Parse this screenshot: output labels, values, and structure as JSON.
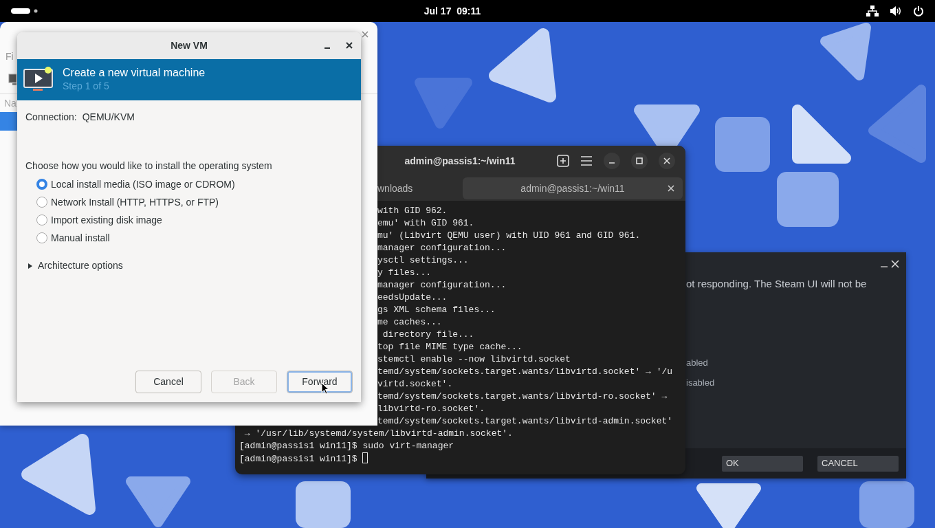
{
  "top_bar": {
    "clock": "Jul 17  09:11"
  },
  "vm_manager_window": {
    "menu_fragment": "Fi",
    "column_fragment": "Na"
  },
  "new_vm_dialog": {
    "title": "New VM",
    "header": {
      "title": "Create a new virtual machine",
      "subtitle": "Step 1 of 5"
    },
    "connection_label": "Connection:",
    "connection_value": "QEMU/KVM",
    "prompt": "Choose how you would like to install the operating system",
    "options": [
      {
        "label": "Local install media (ISO image or CDROM)",
        "selected": true
      },
      {
        "label": "Network Install (HTTP, HTTPS, or FTP)",
        "selected": false
      },
      {
        "label": "Import existing disk image",
        "selected": false
      },
      {
        "label": "Manual install",
        "selected": false
      }
    ],
    "expander": {
      "label": "Architecture options",
      "expanded": false
    },
    "buttons": [
      {
        "label": "Cancel",
        "disabled": false,
        "focused": false
      },
      {
        "label": "Back",
        "disabled": true,
        "focused": false
      },
      {
        "label": "Forward",
        "disabled": false,
        "focused": true
      }
    ]
  },
  "terminal_window": {
    "title": "admin@passis1:~/win11",
    "tabs": [
      {
        "label": "wnloads",
        "selected": false
      },
      {
        "label": "admin@passis1:~/win11",
        "selected": true
      }
    ],
    "lines": [
      {
        "kind": "cut",
        "text": "with GID 962."
      },
      {
        "kind": "cut",
        "text": "emu' with GID 961."
      },
      {
        "kind": "cut",
        "text": "mu' (Libvirt QEMU user) with UID 961 and GID 961."
      },
      {
        "kind": "cut",
        "text": "manager configuration..."
      },
      {
        "kind": "cut",
        "text": "ysctl settings..."
      },
      {
        "kind": "cut",
        "text": "y files..."
      },
      {
        "kind": "cut",
        "text": "manager configuration..."
      },
      {
        "kind": "cut",
        "text": "eedsUpdate..."
      },
      {
        "kind": "cut",
        "text": "gs XML schema files..."
      },
      {
        "kind": "cut",
        "text": "me caches..."
      },
      {
        "kind": "cut",
        "text": " directory file..."
      },
      {
        "kind": "cut",
        "text": "top file MIME type cache..."
      },
      {
        "kind": "cut",
        "text": "stemctl enable --now libvirtd.socket"
      },
      {
        "kind": "cut",
        "text": "temd/system/sockets.target.wants/libvirtd.socket' → '/u"
      },
      {
        "kind": "cut",
        "text": "virtd.socket'."
      },
      {
        "kind": "cut",
        "text": "temd/system/sockets.target.wants/libvirtd-ro.socket' →"
      },
      {
        "kind": "cut",
        "text": "libvirtd-ro.socket'."
      },
      {
        "kind": "cut",
        "text": "temd/system/sockets.target.wants/libvirtd-admin.socket'"
      },
      {
        "kind": "full",
        "text": " → '/usr/lib/systemd/system/libvirtd-admin.socket'."
      },
      {
        "kind": "full",
        "text": "[admin@passis1 win11]$ sudo virt-manager"
      },
      {
        "kind": "prompt",
        "text": "[admin@passis1 win11]$ "
      }
    ]
  },
  "steam_dialog": {
    "message": "ot responding. The Steam UI will not be",
    "options": [
      "abled",
      "isabled"
    ],
    "buttons": [
      "OK",
      "CANCEL"
    ]
  }
}
